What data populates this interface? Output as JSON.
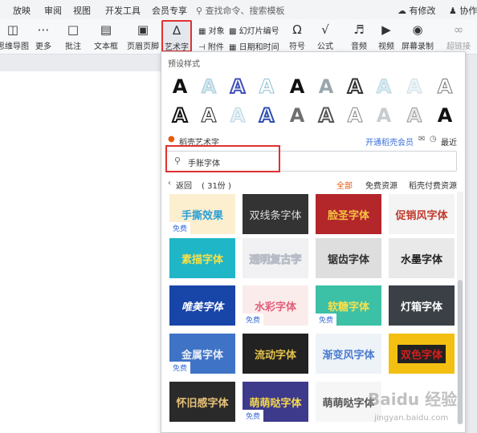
{
  "menubar": {
    "items": [
      "放映",
      "审阅",
      "视图",
      "开发工具",
      "会员专享"
    ],
    "search_placeholder": "查找命令、搜索模板",
    "has_changes": "有修改",
    "collab": "协作"
  },
  "ribbon": {
    "mindmap": "思维导图",
    "more": "更多",
    "comment": "批注",
    "textbox": "文本框",
    "header_footer": "页眉页脚",
    "wordart": "艺术字",
    "object": "对象",
    "slide_number": "幻灯片编号",
    "attachment": "附件",
    "datetime": "日期和时间",
    "symbol": "符号",
    "formula": "公式",
    "audio": "音频",
    "video": "视频",
    "screen_record": "屏幕录制",
    "hyperlink": "超链接"
  },
  "panel": {
    "preset_title": "预设样式",
    "glyph_char": "A",
    "source_label": "稻壳艺术字",
    "open_member": "开通稻壳会员",
    "recent": "最近",
    "search_value": "手账字体",
    "back": "返回",
    "count": "( 31份 )",
    "filters": [
      "全部",
      "免费资源",
      "稻壳付费资源"
    ],
    "free_badge": "免费",
    "tiles": [
      {
        "text": "手撕效果",
        "free": true
      },
      {
        "text": "双线条字体",
        "free": false
      },
      {
        "text": "脸圣字体",
        "free": false
      },
      {
        "text": "促销风字体",
        "free": false
      },
      {
        "text": "素描字体",
        "free": false
      },
      {
        "text": "透明复古字",
        "free": false
      },
      {
        "text": "锯齿字体",
        "free": false
      },
      {
        "text": "水墨字体",
        "free": false
      },
      {
        "text": "唯美字体",
        "free": false
      },
      {
        "text": "水彩字体",
        "free": true
      },
      {
        "text": "软糖字体",
        "free": true
      },
      {
        "text": "灯箱字体",
        "free": false
      },
      {
        "text": "金属字体",
        "free": true
      },
      {
        "text": "流动字体",
        "free": false
      },
      {
        "text": "渐变风字体",
        "free": false
      },
      {
        "text": "双色字体",
        "free": false
      },
      {
        "text": "怀旧感字体",
        "free": false
      },
      {
        "text": "萌萌哒字体",
        "free": true
      },
      {
        "text": "萌萌哒字体",
        "free": false
      }
    ]
  },
  "watermark": {
    "brand": "Baidu 经验",
    "url": "jingyan.baidu.com"
  }
}
